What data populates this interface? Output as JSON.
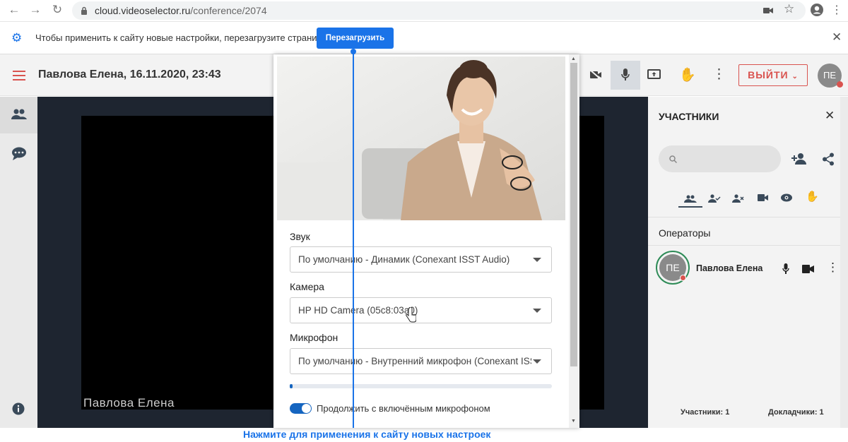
{
  "browser": {
    "url_host": "cloud.videoselector.ru",
    "url_path": "/conference/2074",
    "icons": [
      "back-icon",
      "forward-icon",
      "reload-icon",
      "lock-icon",
      "camera-icon",
      "star-icon",
      "account-icon"
    ]
  },
  "infobar": {
    "message": "Чтобы применить к сайту новые настройки, перезагрузите страницу",
    "reload_label": "Перезагрузить",
    "icons": [
      "gear-icon",
      "close-icon"
    ]
  },
  "header": {
    "title": "Павлова Елена, 16.11.2020, 23:43",
    "exit_label": "ВЫЙТИ",
    "avatar_initials": "ПЕ",
    "icons": [
      "hamburger-icon",
      "camera-off-icon",
      "mic-icon",
      "screen-share-icon",
      "raise-hand-icon",
      "more-vert-icon"
    ]
  },
  "video": {
    "speaker_name": "Павлова Елена"
  },
  "modal": {
    "sound_label": "Звук",
    "sound_value": "По умолчанию - Динамик (Conexant ISST Audio)",
    "camera_label": "Камера",
    "camera_value": "HP HD Camera (05c8:03a0)",
    "mic_label": "Микрофон",
    "mic_value": "По умолчанию - Внутренний микрофон (Conexant ISS...",
    "mic_level": 0.01,
    "continue_label": "Продолжить с включённым микрофоном",
    "continue_on": true
  },
  "participants": {
    "title": "УЧАСТНИКИ",
    "operators_label": "Операторы",
    "operator": {
      "initials": "ПЕ",
      "name": "Павлова Елена"
    },
    "participants_count": "Участники: 1",
    "speakers_count": "Докладчики: 1"
  },
  "annotation": {
    "text": "Нажмите для применения к сайту новых настроек"
  },
  "colors": {
    "accent": "#1a73e8",
    "exit": "#d9534f",
    "toggle": "#1565c0",
    "online": "#2e8b57"
  }
}
